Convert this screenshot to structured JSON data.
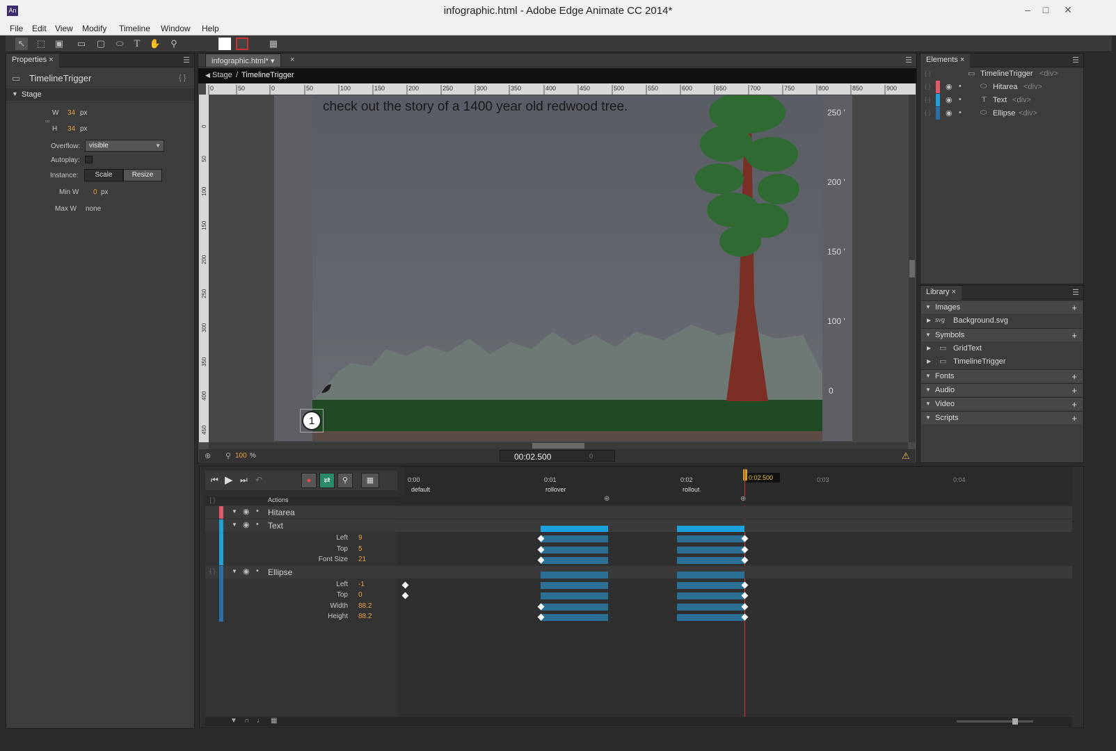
{
  "window": {
    "title": "infographic.html - Adobe Edge Animate CC 2014*",
    "app_icon": "An",
    "controls": [
      "minimize-icon",
      "maximize-icon",
      "close-icon"
    ]
  },
  "menu": [
    "File",
    "Edit",
    "View",
    "Modify",
    "Timeline",
    "Window",
    "Help"
  ],
  "properties": {
    "tab": "Properties",
    "symbol_name": "TimelineTrigger",
    "section": "Stage",
    "w_label": "W",
    "w_value": "34",
    "w_unit": "px",
    "h_label": "H",
    "h_value": "34",
    "h_unit": "px",
    "overflow_label": "Overflow:",
    "overflow_value": "visible",
    "autoplay_label": "Autoplay:",
    "instance_label": "Instance:",
    "scale_label": "Scale",
    "resize_label": "Resize",
    "minw_label": "Min W",
    "minw_value": "0",
    "minw_unit": "px",
    "maxw_label": "Max W",
    "maxw_value": "none"
  },
  "document": {
    "tab": "infographic.html*",
    "breadcrumb_root": "Stage",
    "breadcrumb_sep": "/",
    "breadcrumb_current": "TimelineTrigger",
    "ruler_h": [
      "0",
      "50",
      "0",
      "50",
      "100",
      "150",
      "200",
      "250",
      "300",
      "350",
      "400",
      "450",
      "500",
      "550",
      "600",
      "650",
      "700",
      "750",
      "800",
      "850",
      "900"
    ],
    "ruler_v": [
      "0",
      "50",
      "100",
      "150",
      "200",
      "250",
      "300",
      "350",
      "400",
      "450"
    ],
    "stage_text": "check out the story of a 1400 year old redwood tree.",
    "scale_labels": [
      "250 '",
      "200 '",
      "150 '",
      "100 '",
      "0"
    ],
    "trigger_number": "1",
    "zoom": "100",
    "zoom_unit": "%",
    "time_display": "00:02.500",
    "time_secondary": "0"
  },
  "elements": {
    "tab": "Elements",
    "items": [
      {
        "name": "TimelineTrigger",
        "tag": "<div>",
        "color": ""
      },
      {
        "name": "Hitarea",
        "tag": "<div>",
        "color": "#e05a6a"
      },
      {
        "name": "Text",
        "tag": "<div>",
        "color": "#1ca1de"
      },
      {
        "name": "Ellipse",
        "tag": "<div>",
        "color": "#2b6fa8"
      }
    ]
  },
  "library": {
    "tab": "Library",
    "sections": [
      "Images",
      "Symbols",
      "Fonts",
      "Audio",
      "Video",
      "Scripts"
    ],
    "images": [
      "Background.svg"
    ],
    "symbols": [
      "GridText",
      "TimelineTrigger"
    ],
    "svg_tag": "svg"
  },
  "timeline": {
    "ticks": [
      "0:00",
      "0:01",
      "0:02",
      "0:03",
      "0:04"
    ],
    "playhead": "0:02.500",
    "labels": [
      "default",
      "rollover",
      "rollout"
    ],
    "actions_label": "Actions",
    "rows": {
      "hitarea": "Hitarea",
      "text": "Text",
      "text_props": [
        {
          "name": "Left",
          "value": "9"
        },
        {
          "name": "Top",
          "value": "5"
        },
        {
          "name": "Font Size",
          "value": "21"
        }
      ],
      "ellipse": "Ellipse",
      "ellipse_props": [
        {
          "name": "Left",
          "value": "-1"
        },
        {
          "name": "Top",
          "value": "0"
        },
        {
          "name": "Width",
          "value": "88.2"
        },
        {
          "name": "Height",
          "value": "88.2"
        }
      ]
    }
  },
  "colors": {
    "accent_orange": "#e8a33a",
    "text_track": "#1ca1de",
    "ellipse_track": "#2b6fa8",
    "hitarea_track": "#e05a6a",
    "playhead": "#e0303a"
  }
}
